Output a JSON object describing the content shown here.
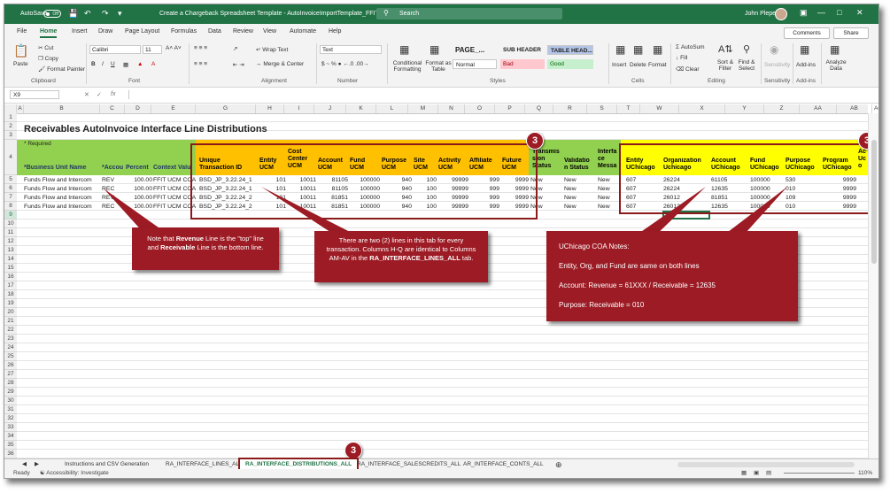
{
  "titlebar": {
    "autosave": "AutoSave",
    "toggle": "Off",
    "document_title": "Create a Chargeback Spreadsheet Template - AutoInvoiceImportTemplate_FFIT_B...",
    "search_placeholder": "Search",
    "user_name": "John Plepel",
    "accent": "#217346"
  },
  "menu": [
    "File",
    "Home",
    "Insert",
    "Draw",
    "Page Layout",
    "Formulas",
    "Data",
    "Review",
    "View",
    "Automate",
    "Help"
  ],
  "menu_active": "Home",
  "comments_label": "Comments",
  "share_label": "Share",
  "ribbon": {
    "paste": "Paste",
    "cut": "Cut",
    "copy": "Copy",
    "format_painter": "Format Painter",
    "clipboard": "Clipboard",
    "font_name": "Calibri",
    "font_size": "11",
    "font": "Font",
    "wrap_text": "Wrap Text",
    "merge_center": "Merge & Center",
    "alignment": "Alignment",
    "number_format": "Text",
    "number": "Number",
    "conditional_formatting": "Conditional Formatting",
    "format_as_table": "Format as Table",
    "styles_row1": [
      "PAGE_...",
      "SUB HEADER",
      "TABLE HEAD..."
    ],
    "styles_row2": [
      "Normal",
      "Bad",
      "Good"
    ],
    "styles": "Styles",
    "insert": "Insert",
    "delete": "Delete",
    "format": "Format",
    "cells": "Cells",
    "autosum": "AutoSum",
    "fill": "Fill",
    "clear": "Clear",
    "sort_filter": "Sort & Filter",
    "find_select": "Find & Select",
    "editing": "Editing",
    "sensitivity": "Sensitivity",
    "addins": "Add-ins",
    "analyze_data": "Analyze Data"
  },
  "formula_bar": {
    "name_box": "X9",
    "fx": "fx",
    "value": ""
  },
  "columns": [
    "A",
    "B",
    "C",
    "D",
    "E",
    "G",
    "H",
    "I",
    "J",
    "K",
    "L",
    "M",
    "N",
    "O",
    "P",
    "Q",
    "R",
    "S",
    "T",
    "W",
    "X",
    "Y",
    "Z",
    "AA",
    "AB",
    "AC"
  ],
  "rows": [
    "1",
    "2",
    "3",
    "4",
    "5",
    "6",
    "7",
    "8",
    "9",
    "10",
    "11",
    "12",
    "13",
    "14",
    "15",
    "16",
    "17",
    "18",
    "19",
    "20",
    "21",
    "22",
    "23",
    "24",
    "25",
    "26",
    "27",
    "28",
    "29",
    "30",
    "31",
    "32",
    "33",
    "34",
    "35",
    "36",
    "37",
    "38",
    "39"
  ],
  "sheet": {
    "title": "Receivables AutoInvoice Interface Line Distributions",
    "required": "* Required",
    "headers": {
      "business_unit": "*Business Unit Name",
      "account_class": "*Accou",
      "percent": "Percent",
      "context": "Context Valu",
      "unique_txn": "Unique Transaction ID",
      "entity": "Entity UCM",
      "cost_center": "Cost Center UCM",
      "account": "Account UCM",
      "fund": "Fund UCM",
      "purpose": "Purpose UCM",
      "site": "Site UCM",
      "activity": "Activity UCM",
      "affiliate": "Affiliate UCM",
      "future": "Future UCM",
      "transmission": "Transmis sion Status",
      "validation": "Validatio n Status",
      "interface": "Interfa ce Messa",
      "entity_uc": "Entity UChicago",
      "org_uc": "Organization Uchicago",
      "account_uc": "Account UChicago",
      "fund_uc": "Fund UChicago",
      "purpose_uc": "Purpose UChicago",
      "program_uc": "Program UChicago",
      "ac_uc": "Ac Uc o"
    },
    "data_rows": [
      [
        "Funds Flow and Intercom",
        "REV",
        "100.00",
        "FFIT UCM COA",
        "BSD_JP_3.22.24_1",
        "101",
        "10011",
        "81105",
        "100000",
        "940",
        "100",
        "99999",
        "999",
        "9999",
        "New",
        "New",
        "New",
        "607",
        "26224",
        "61105",
        "100000",
        "530",
        "9999"
      ],
      [
        "Funds Flow and Intercom",
        "REC",
        "100.00",
        "FFIT UCM COA",
        "BSD_JP_3.22.24_1",
        "101",
        "10011",
        "81105",
        "100000",
        "940",
        "100",
        "99999",
        "999",
        "9999",
        "New",
        "New",
        "New",
        "607",
        "26224",
        "12635",
        "100000",
        "010",
        "9999"
      ],
      [
        "Funds Flow and Intercom",
        "REV",
        "100.00",
        "FFIT UCM COA",
        "BSD_JP_3.22.24_2",
        "101",
        "10011",
        "81851",
        "100000",
        "940",
        "100",
        "99999",
        "999",
        "9999",
        "New",
        "New",
        "New",
        "607",
        "26012",
        "81851",
        "100000",
        "109",
        "9999"
      ],
      [
        "Funds Flow and Intercom",
        "REC",
        "100.00",
        "FFIT UCM COA",
        "BSD_JP_3.22.24_2",
        "101",
        "10011",
        "81851",
        "100000",
        "940",
        "100",
        "99999",
        "999",
        "9999",
        "New",
        "New",
        "New",
        "607",
        "26012",
        "12635",
        "100000",
        "010",
        "9999"
      ]
    ]
  },
  "callouts": {
    "revenue_note_parts": [
      "Note that ",
      "Revenue",
      " Line is the \"top\" line and ",
      "Receivable",
      " Line is the bottom line."
    ],
    "two_lines_note_parts": [
      "There are two (2) lines in this tab for every transaction.  Columns H-Q are identical to Columns AM-AV in  the ",
      "RA_INTERFACE_LINES_ALL",
      " tab."
    ],
    "uchicago_title": "UChicago COA Notes:",
    "uchicago_lines": [
      "Entity, Org, and Fund are same on both lines",
      "Account: Revenue = 61XXX / Receivable  = 12635",
      "Purpose: Receivable = 010"
    ],
    "badge": "3"
  },
  "sheet_tabs": [
    "Instructions and CSV Generation",
    "RA_INTERFACE_LINES_ALL",
    "RA_INTERFACE_DISTRIBUTIONS_ALL",
    "RA_INTERFACE_SALESCREDITS_ALL",
    "AR_INTERFACE_CONTS_ALL"
  ],
  "active_tab": "RA_INTERFACE_DISTRIBUTIONS_ALL",
  "status": {
    "ready": "Ready",
    "accessibility": "Accessibility: Investigate",
    "zoom": "110%"
  },
  "colors": {
    "green_header": "#92d050",
    "orange_header": "#ffc000",
    "yellow_header": "#ffff00",
    "callout": "#9c1b24"
  }
}
